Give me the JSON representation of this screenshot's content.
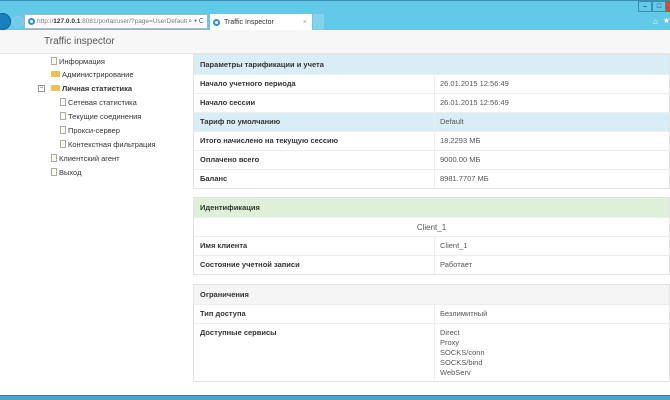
{
  "browser": {
    "url_prefix": "http://",
    "url_host": "127.0.0.1",
    "url_rest": ":8081/portal/user/?page=UserDefault",
    "addr_tools": "⌕ ▾ C",
    "tab_title": "Traffic Inspector",
    "tab_close": "×",
    "min": "‒",
    "max": "□",
    "home": "⌂",
    "star": "★"
  },
  "header": {
    "brand": "Traffic inspector"
  },
  "tree": {
    "items": [
      "Информация",
      "Администрирование",
      "Личная статистика",
      "Сетевая статистика",
      "Текущие соединения",
      "Прокси-сервер",
      "Контекстная фильтрация",
      "Клиентский агент",
      "Выход"
    ],
    "expander": "−"
  },
  "billing": {
    "title": "Параметры тарификации и учета",
    "rows": [
      {
        "k": "Начало учетного периода",
        "v": "26.01.2015 12:56:49"
      },
      {
        "k": "Начало сессии",
        "v": "26.01.2015 12:56:49"
      },
      {
        "k": "Тариф по умолчанию",
        "v": "Default"
      },
      {
        "k": "Итого начислено на текущую сессию",
        "v": "18.2293 МБ"
      },
      {
        "k": "Оплачено всего",
        "v": "9000.00 МБ"
      },
      {
        "k": "Баланс",
        "v": "8981.7707 МБ"
      }
    ]
  },
  "ident": {
    "title": "Идентификация",
    "client": "Client_1",
    "rows": [
      {
        "k": "Имя клиента",
        "v": "Client_1"
      },
      {
        "k": "Состояние учетной записи",
        "v": "Работает"
      }
    ]
  },
  "limits": {
    "title": "Ограничения",
    "access_k": "Тип доступа",
    "access_v": "Безлимитный",
    "services_k": "Доступные сервисы",
    "services": [
      "Direct",
      "Proxy",
      "SOCKS/conn",
      "SOCKS/bind",
      "WebServ"
    ]
  }
}
